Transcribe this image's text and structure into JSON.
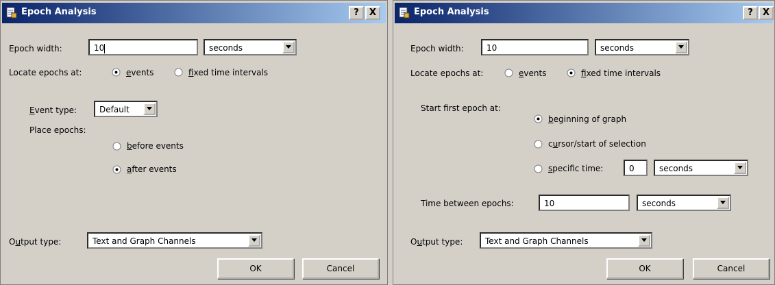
{
  "left": {
    "title": "Epoch Analysis",
    "help_glyph": "?",
    "close_glyph": "X",
    "epoch_width_label": "Epoch width:",
    "epoch_width_value": "10",
    "epoch_width_unit": "seconds",
    "locate_label": "Locate epochs at:",
    "opt_events": "events",
    "opt_fixed": "fixed time intervals",
    "event_type_label": "Event type:",
    "event_type_value": "Default",
    "place_label": "Place epochs:",
    "opt_before": "before events",
    "opt_after": "after events",
    "output_type_label": "Output type:",
    "output_type_value": "Text and Graph Channels",
    "ok_label": "OK",
    "cancel_label": "Cancel"
  },
  "right": {
    "title": "Epoch Analysis",
    "help_glyph": "?",
    "close_glyph": "X",
    "epoch_width_label": "Epoch width:",
    "epoch_width_value": "10",
    "epoch_width_unit": "seconds",
    "locate_label": "Locate epochs at:",
    "opt_events": "events",
    "opt_fixed": "fixed time intervals",
    "start_label": "Start first epoch at:",
    "opt_beginning": "beginning of graph",
    "opt_cursor": "cursor/start of selection",
    "opt_specific": "specific time:",
    "specific_value": "0",
    "specific_unit": "seconds",
    "between_label": "Time between epochs:",
    "between_value": "10",
    "between_unit": "seconds",
    "output_type_label": "Output type:",
    "output_type_value": "Text and Graph Channels",
    "ok_label": "OK",
    "cancel_label": "Cancel"
  }
}
